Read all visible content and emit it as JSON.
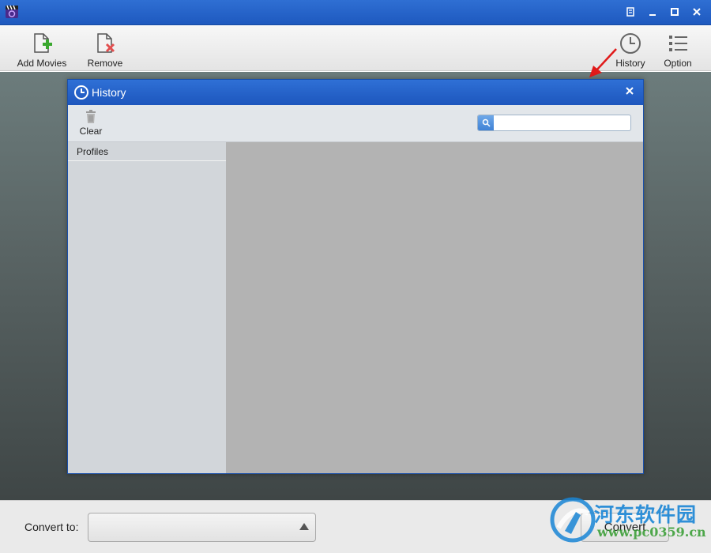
{
  "window": {
    "title": "",
    "icon": "clapperboard-icon",
    "controls": [
      "restore-alt-icon",
      "minimize-icon",
      "maximize-icon",
      "close-icon"
    ]
  },
  "toolbar": {
    "add_movies_label": "Add Movies",
    "remove_label": "Remove",
    "history_label": "History",
    "option_label": "Option"
  },
  "history_dialog": {
    "title": "History",
    "clear_label": "Clear",
    "search_placeholder": "",
    "search_value": "",
    "sidebar": {
      "items": [
        {
          "label": "Profiles"
        }
      ]
    }
  },
  "bottombar": {
    "convert_to_label": "Convert to:",
    "convert_select_value": "",
    "convert_button_label": "Convert"
  },
  "watermark": {
    "title": "河东软件园",
    "url": "www.pc0359.cn"
  },
  "colors": {
    "titlebar_blue": "#2f6fd3",
    "annotation_red": "#e01a1a",
    "watermark_blue": "#1a86d6",
    "watermark_green": "#3ea03a"
  }
}
